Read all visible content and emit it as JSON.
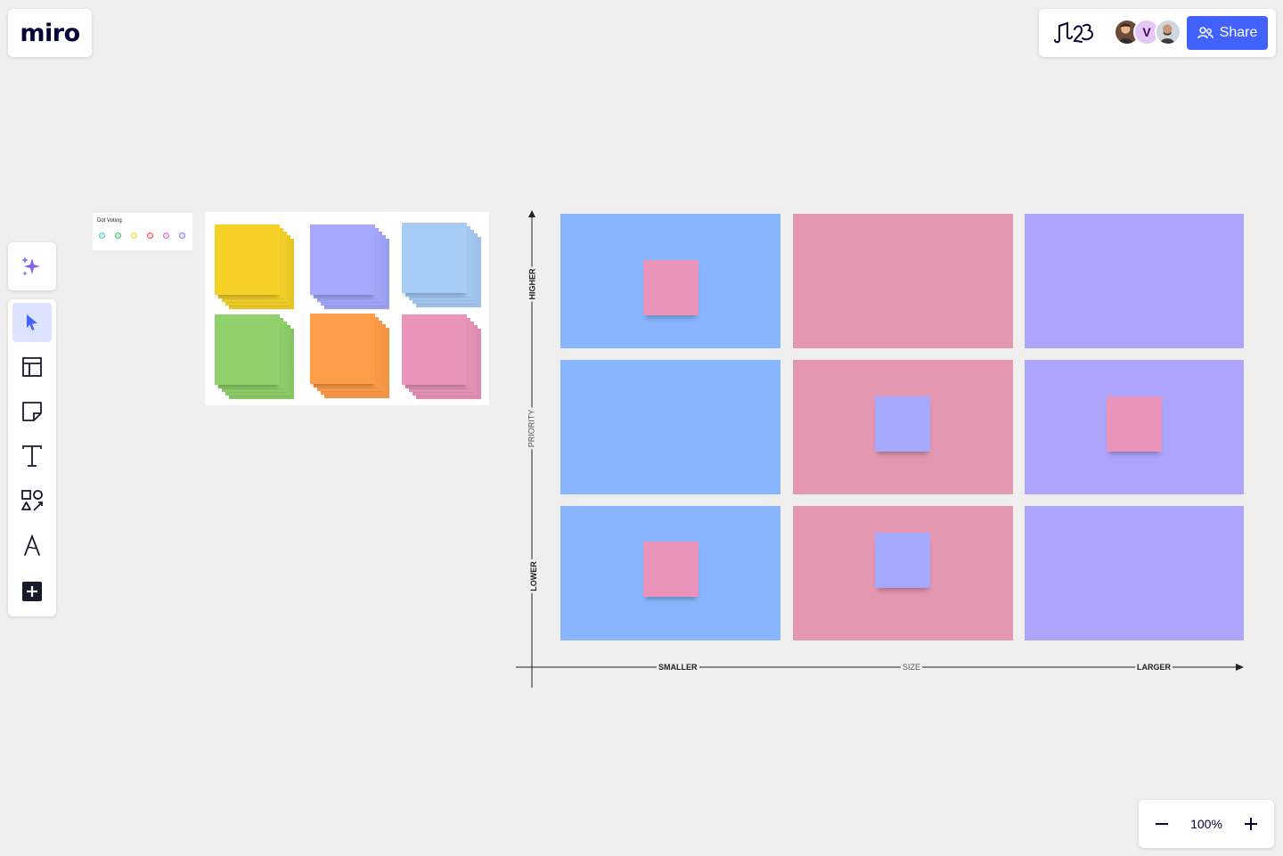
{
  "app": {
    "logo": "miro"
  },
  "header": {
    "share_label": "Share",
    "avatar_initial": "V"
  },
  "zoom": {
    "level": "100%"
  },
  "dot_voting": {
    "title": "Dot Voting",
    "dot_colors": [
      "#45c6d6",
      "#3ac569",
      "#f0d43a",
      "#e45a6a",
      "#d66bd9",
      "#8d7ef0"
    ]
  },
  "sticky_stacks": [
    {
      "color": "#f5d128",
      "name": "yellow"
    },
    {
      "color": "#a5a8fc",
      "name": "violet"
    },
    {
      "color": "#a6ccf5",
      "name": "light-blue"
    },
    {
      "color": "#8fd16a",
      "name": "green"
    },
    {
      "color": "#ff9d48",
      "name": "orange"
    },
    {
      "color": "#ea94bb",
      "name": "pink"
    }
  ],
  "matrix": {
    "y_axis": {
      "top": "HIGHER",
      "middle": "PRIORITY",
      "bottom": "LOWER"
    },
    "x_axis": {
      "left": "SMALLER",
      "middle": "SIZE",
      "right": "LARGER"
    },
    "column_colors": [
      "#88b5fd",
      "#e497b0",
      "#ada4fc"
    ],
    "stickies": [
      {
        "row": 0,
        "col": 0,
        "color": "#ea94bb"
      },
      {
        "row": 1,
        "col": 1,
        "color": "#a5a8fc"
      },
      {
        "row": 1,
        "col": 2,
        "color": "#ea94bb"
      },
      {
        "row": 2,
        "col": 0,
        "color": "#ea94bb"
      },
      {
        "row": 2,
        "col": 1,
        "color": "#a5a8fc"
      }
    ]
  },
  "toolbar": {
    "tools": [
      "ai-assist",
      "select",
      "templates",
      "sticky-note",
      "text",
      "shapes",
      "pen",
      "add-more"
    ]
  }
}
